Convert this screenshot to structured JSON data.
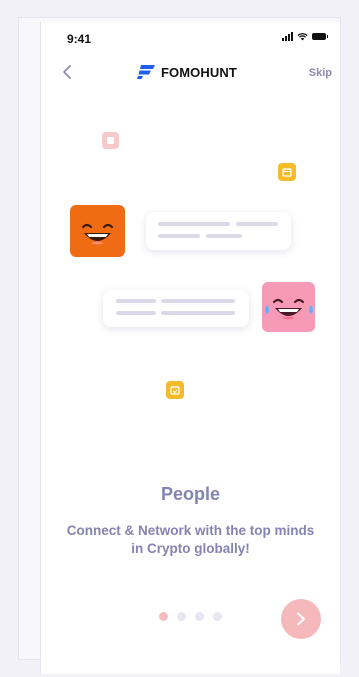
{
  "status_bar": {
    "time": "9:41"
  },
  "header": {
    "brand": "FOMOHUNT",
    "skip_label": "Skip"
  },
  "onboarding": {
    "title": "People",
    "description": "Connect & Network with the top minds in Crypto globally!",
    "current_step": 1,
    "total_steps": 4
  },
  "icons": {
    "back": "chevron-left-icon",
    "next": "chevron-right-icon",
    "logo": "fomohunt-logo-icon"
  },
  "colors": {
    "accent_pink": "#f6b9bb",
    "text_muted": "#8484b0",
    "emoji_orange": "#f06c14",
    "emoji_pink": "#f79ab8",
    "badge_yellow": "#f5bb2a",
    "badge_pink": "#f8c9c9",
    "brand_blue": "#1f5ff0"
  }
}
